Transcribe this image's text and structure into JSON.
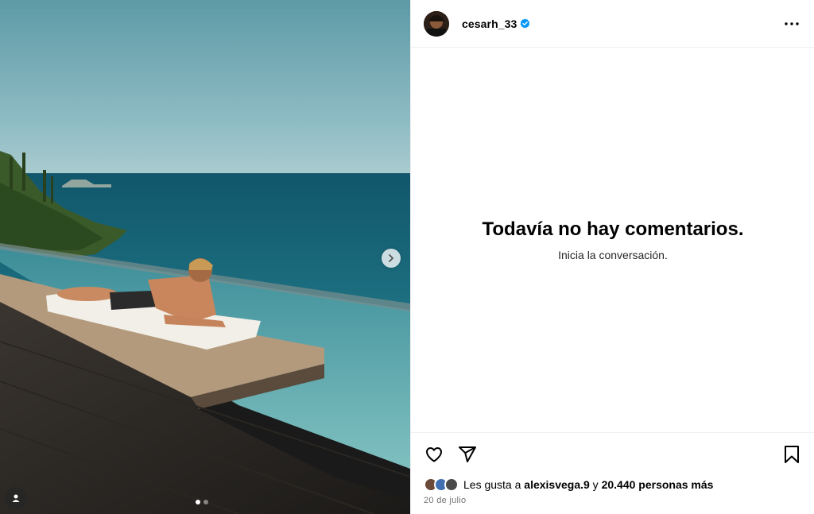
{
  "post": {
    "username": "cesarh_33",
    "verified": true,
    "more_icon": "more-horizontal-icon"
  },
  "comments": {
    "empty_title": "Todavía no hay comentarios.",
    "empty_subtitle": "Inicia la conversación."
  },
  "actions": {
    "like_icon": "heart-icon",
    "share_icon": "send-icon",
    "save_icon": "bookmark-icon"
  },
  "likes": {
    "prefix": "Les gusta a ",
    "user": "alexisvega.9",
    "connector": " y ",
    "others": "20.440 personas más"
  },
  "date": "20 de julio",
  "carousel": {
    "current_index": 1,
    "total": 2
  },
  "colors": {
    "verified_blue": "#0095f6",
    "divider": "#efefef",
    "secondary_text": "#737373"
  }
}
